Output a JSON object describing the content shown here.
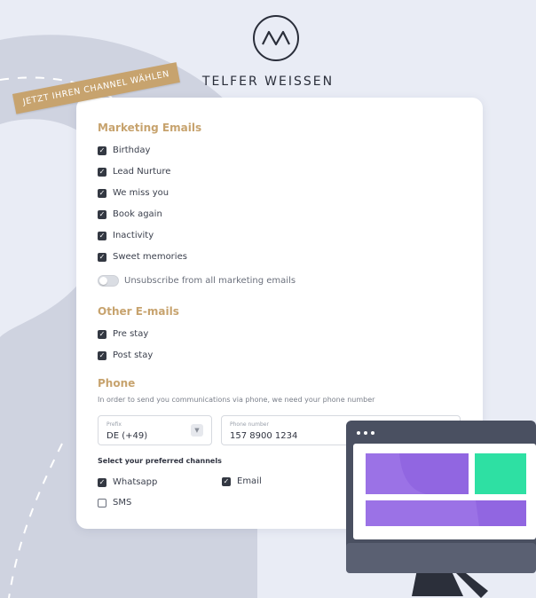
{
  "brand": {
    "name": "TELFER WEISSEN",
    "logo_icon": "mountain-logo-icon"
  },
  "ribbon": {
    "text": "JETZT IHREN CHANNEL WÄHLEN"
  },
  "marketing": {
    "title": "Marketing Emails",
    "items": [
      {
        "label": "Birthday",
        "checked": true
      },
      {
        "label": "Lead Nurture",
        "checked": true
      },
      {
        "label": "We miss you",
        "checked": true
      },
      {
        "label": "Book again",
        "checked": true
      },
      {
        "label": "Inactivity",
        "checked": true
      },
      {
        "label": "Sweet memories",
        "checked": true
      }
    ],
    "unsubscribe_label": "Unsubscribe from all marketing emails",
    "unsubscribe_on": false
  },
  "other": {
    "title": "Other E-mails",
    "items": [
      {
        "label": "Pre stay",
        "checked": true
      },
      {
        "label": "Post stay",
        "checked": true
      }
    ]
  },
  "phone": {
    "title": "Phone",
    "helper": "In order to send you communications via phone, we need your phone number",
    "prefix_label": "Prefix",
    "prefix_value": "DE (+49)",
    "number_label": "Phone number",
    "number_value": "157 8900 1234",
    "channels_label": "Select your preferred channels",
    "channels": [
      {
        "label": "Whatsapp",
        "checked": true
      },
      {
        "label": "Email",
        "checked": true
      },
      {
        "label": "SMS",
        "checked": false
      }
    ]
  },
  "colors": {
    "accent": "#c7a36e",
    "background": "#e9ecf5",
    "checkbox": "#333842"
  }
}
